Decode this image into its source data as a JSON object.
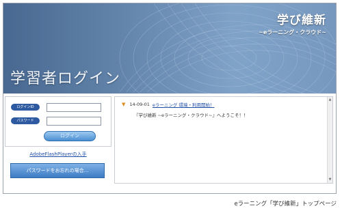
{
  "banner": {
    "logo_main": "学び維新",
    "logo_sub": "~eラーニング・クラウド~",
    "title": "学習者ログイン"
  },
  "login": {
    "id_label": "ログインID",
    "password_label": "パスワード",
    "id_value": "",
    "password_value": "",
    "button_label": "ログイン"
  },
  "links": {
    "flash": "AdobeFlashPlayerの入手",
    "forgot_password": "パスワードをお忘れの場合..."
  },
  "news": {
    "items": [
      {
        "date": "14-09-01",
        "title": "eラーニング 環境・利用開始！",
        "body": "『学び維新 ~eラーニング・クラウド~』へようこそ！！"
      }
    ]
  },
  "caption": "eラーニング「学び維新」トップページ",
  "colors": {
    "accent": "#2d5aa0",
    "link": "#1f4fa8",
    "news_arrow": "#e08a1c"
  },
  "icons": {
    "news_bullet": "triangle-down-icon",
    "scroll_up": "arrow-up-icon",
    "scroll_down": "arrow-down-icon"
  }
}
